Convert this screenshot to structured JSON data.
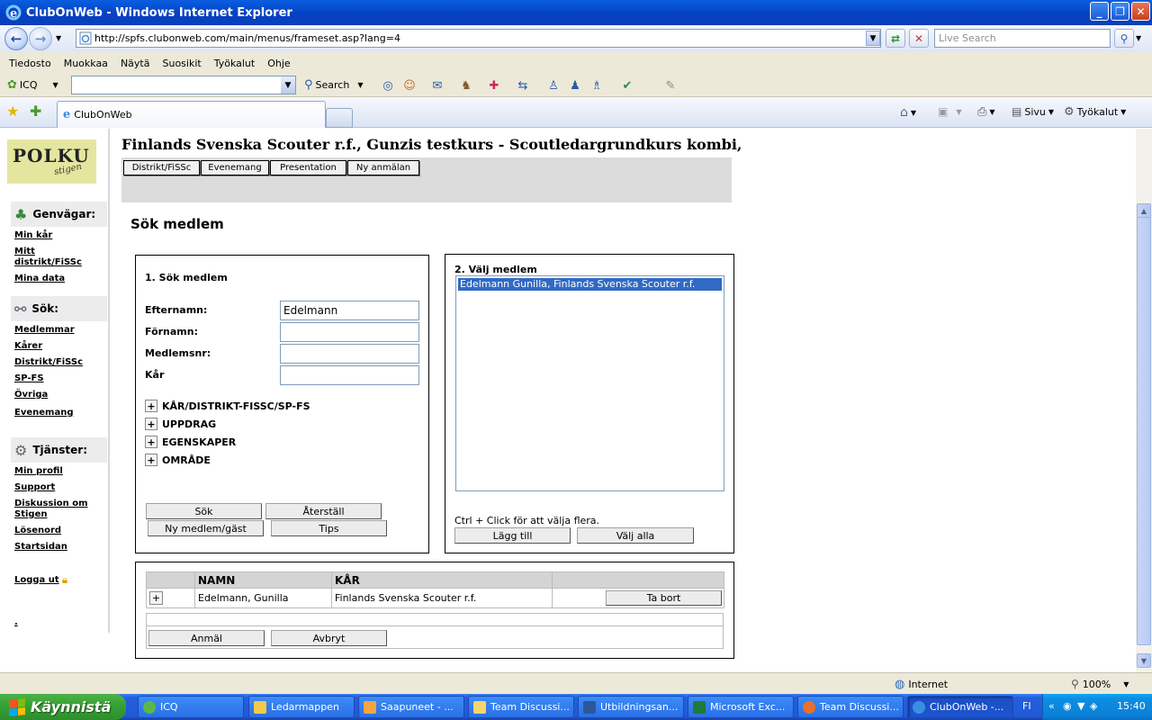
{
  "window": {
    "title": "ClubOnWeb - Windows Internet Explorer"
  },
  "address": {
    "url": "http://spfs.clubonweb.com/main/menus/frameset.asp?lang=4",
    "live_search_placeholder": "Live Search"
  },
  "menu": [
    "Tiedosto",
    "Muokkaa",
    "Näytä",
    "Suosikit",
    "Työkalut",
    "Ohje"
  ],
  "toolbar": {
    "icq_label": "ICQ",
    "search_label": "Search"
  },
  "tabs": {
    "active_tab": "ClubOnWeb",
    "page_label": "Sivu",
    "tools_label": "Työkalut"
  },
  "sidebar": {
    "logo_text": "POLKU",
    "logo_sub": "stigen",
    "shortcuts_heading": "Genvägar:",
    "shortcuts": [
      "Min kår",
      "Mitt distrikt/FiSSc",
      "Mina data"
    ],
    "search_heading": "Sök:",
    "search_links": [
      "Medlemmar",
      "Kårer",
      "Distrikt/FiSSc",
      "SP-FS",
      "Övriga",
      "Evenemang"
    ],
    "services_heading": "Tjänster:",
    "services_links": [
      "Min profil",
      "Support",
      "Diskussion om Stigen",
      "Lösenord",
      "Startsidan"
    ],
    "logout": "Logga ut",
    "dot": "."
  },
  "page": {
    "heading": "Finlands Svenska Scouter r.f., Gunzis testkurs - Scoutledargrundkurs kombi,",
    "top_tabs": [
      "Distrikt/FiSSc",
      "Evenemang",
      "Presentation",
      "Ny anmälan"
    ],
    "title": "Sök medlem"
  },
  "search_panel": {
    "title": "1. Sök medlem",
    "fields": [
      {
        "label": "Efternamn:",
        "value": "Edelmann"
      },
      {
        "label": "Förnamn:",
        "value": ""
      },
      {
        "label": "Medlemsnr:",
        "value": ""
      },
      {
        "label": "Kår",
        "value": ""
      }
    ],
    "expanders": [
      "KÅR/DISTRIKT-FISSC/SP-FS",
      "UPPDRAG",
      "EGENSKAPER",
      "OMRÅDE"
    ],
    "buttons": {
      "search": "Sök",
      "reset": "Återställ",
      "new_member": "Ny medlem/gäst",
      "tips": "Tips"
    }
  },
  "select_panel": {
    "title": "2. Välj medlem",
    "options": [
      "Edelmann Gunilla, Finlands Svenska Scouter r.f."
    ],
    "hint": "Ctrl + Click för att välja flera.",
    "buttons": {
      "add": "Lägg till",
      "select_all": "Välj alla"
    }
  },
  "results": {
    "columns": [
      "",
      "NAMN",
      "KÅR",
      ""
    ],
    "rows": [
      {
        "expand": "+",
        "name": "Edelmann, Gunilla",
        "kar": "Finlands Svenska Scouter r.f.",
        "remove": "Ta bort"
      }
    ],
    "buttons": {
      "register": "Anmäl",
      "cancel": "Avbryt"
    }
  },
  "statusbar": {
    "zone": "Internet",
    "zoom": "100%"
  },
  "taskbar": {
    "start": "Käynnistä",
    "items": [
      {
        "label": "ICQ",
        "color": "#5bb84c"
      },
      {
        "label": "Ledarmappen",
        "color": "#f3c94b"
      },
      {
        "label": "Saapuneet - ...",
        "color": "#f2a541"
      },
      {
        "label": "Team Discussi...",
        "color": "#f7d56a"
      },
      {
        "label": "Utbildningsan...",
        "color": "#2b5797"
      },
      {
        "label": "Microsoft Exc...",
        "color": "#1f7a3a"
      },
      {
        "label": "Team Discussi...",
        "color": "#e8702a"
      },
      {
        "label": "ClubOnWeb -...",
        "color": "#3a8fe0"
      }
    ],
    "lang": "FI",
    "clock": "15:40"
  },
  "colors": {
    "selection": "#316ac5",
    "panel_gray": "#dcdcdc",
    "taskbar_blue": "#245edb"
  }
}
